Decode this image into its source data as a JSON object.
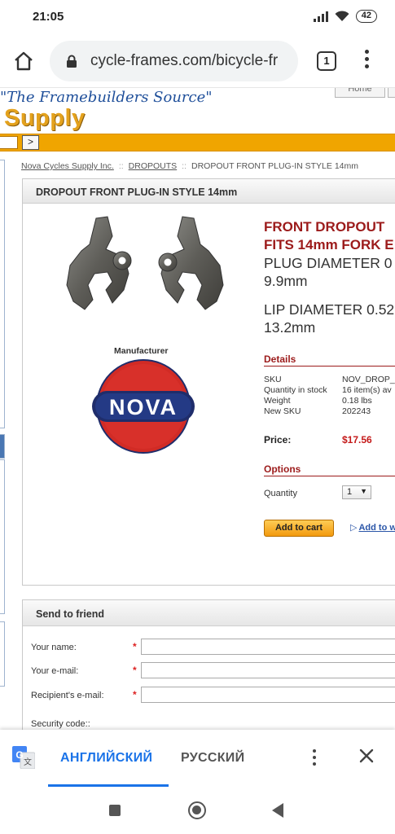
{
  "status_bar": {
    "time": "21:05",
    "battery": "42"
  },
  "browser": {
    "url": "cycle-frames.com/bicycle-fr",
    "tab_count": "1"
  },
  "site": {
    "tagline": "\"The Framebuilders Source\"",
    "brand": "Supply",
    "home_link": "Home",
    "go_button": ">"
  },
  "breadcrumb": {
    "items": [
      "Nova Cycles Supply Inc.",
      "DROPOUTS",
      "DROPOUT FRONT PLUG-IN STYLE 14mm"
    ],
    "separator": "::"
  },
  "product": {
    "panel_title": "DROPOUT FRONT PLUG-IN STYLE 14mm",
    "title_line1": "FRONT  DROPOUT",
    "title_line2": "FITS 14mm FORK E",
    "plug_line1": "PLUG DIAMETER 0",
    "plug_line2": "9.9mm",
    "lip_line1": "LIP DIAMETER 0.52",
    "lip_line2": "13.2mm",
    "manufacturer_label": "Manufacturer",
    "manufacturer_logo_text": "NOVA",
    "details_heading": "Details",
    "details": [
      {
        "label": "SKU",
        "value": "NOV_DROP_1"
      },
      {
        "label": "Quantity in stock",
        "value": "16 item(s) av"
      },
      {
        "label": "Weight",
        "value": "0.18 lbs"
      },
      {
        "label": "New SKU",
        "value": "202243"
      }
    ],
    "price_label": "Price:",
    "price_value": "$17.56",
    "options_heading": "Options",
    "quantity_label": "Quantity",
    "quantity_value": "1",
    "add_to_cart": "Add to cart",
    "add_to_wishlist": "Add to w"
  },
  "send_to_friend": {
    "title": "Send to friend",
    "your_name": "Your name:",
    "your_email": "Your e-mail:",
    "recipient_email": "Recipient's e-mail:",
    "security_code": "Security code::",
    "required_mark": "*"
  },
  "translate_bar": {
    "lang_source": "АНГЛИЙСКИЙ",
    "lang_target": "РУССКИЙ"
  },
  "colors": {
    "accent_orange": "#f0a500",
    "price_red": "#c41a1a",
    "heading_red": "#9c1b1b",
    "link_blue": "#2b56a8",
    "translate_blue": "#1a73e8"
  },
  "icons": {
    "home": "home-icon",
    "lock": "lock-icon",
    "menu": "more-vert-icon",
    "translate": "google-translate-icon",
    "close": "close-icon",
    "wifi": "wifi-icon",
    "signal": "signal-icon"
  }
}
